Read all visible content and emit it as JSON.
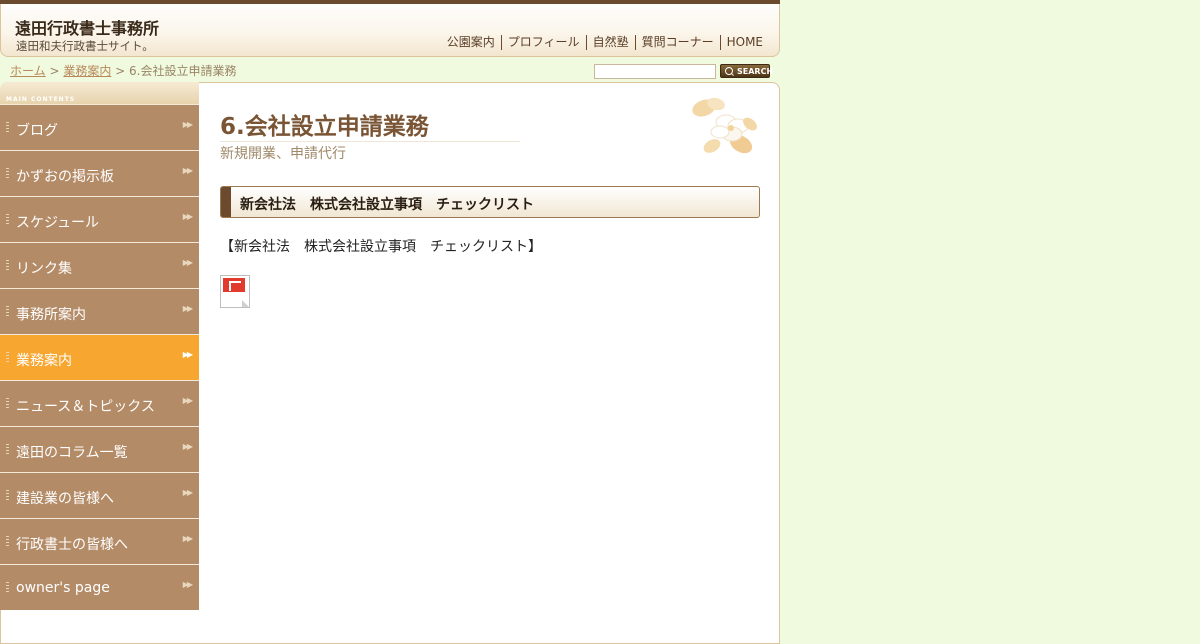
{
  "header": {
    "site_title": "遠田行政書士事務所",
    "site_subtitle": "遠田和夫行政書士サイト。",
    "nav": [
      "公園案内",
      "プロフィール",
      "自然塾",
      "質問コーナー",
      "HOME"
    ]
  },
  "breadcrumb": {
    "home": "ホーム",
    "separator1": " > ",
    "parent": "業務案内",
    "separator2": " > ",
    "current": "6.会社設立申請業務"
  },
  "search": {
    "placeholder": "",
    "button_label": "SEARCH"
  },
  "sidebar": {
    "heading": "main contents",
    "items": [
      {
        "label": "ブログ"
      },
      {
        "label": "かずおの掲示板"
      },
      {
        "label": "スケジュール"
      },
      {
        "label": "リンク集"
      },
      {
        "label": "事務所案内"
      },
      {
        "label": "業務案内",
        "active": true
      },
      {
        "label": "ニュース＆トピックス"
      },
      {
        "label": "遠田のコラム一覧"
      },
      {
        "label": "建設業の皆様へ"
      },
      {
        "label": "行政書士の皆様へ"
      },
      {
        "label": "owner's page"
      }
    ],
    "arrow_glyph": "▶▶"
  },
  "main": {
    "title": "6.会社設立申請業務",
    "subtitle": "新規開業、申請代行",
    "section_heading": "新会社法　株式会社設立事項　チェックリスト",
    "body_text": "【新会社法　株式会社設立事項　チェックリスト】"
  },
  "colors": {
    "page_bg": "#effadf",
    "sidebar_item": "#b48b67",
    "sidebar_active": "#f7a730",
    "title_brown": "#7a5535",
    "header_bar": "#6b4a2e"
  }
}
